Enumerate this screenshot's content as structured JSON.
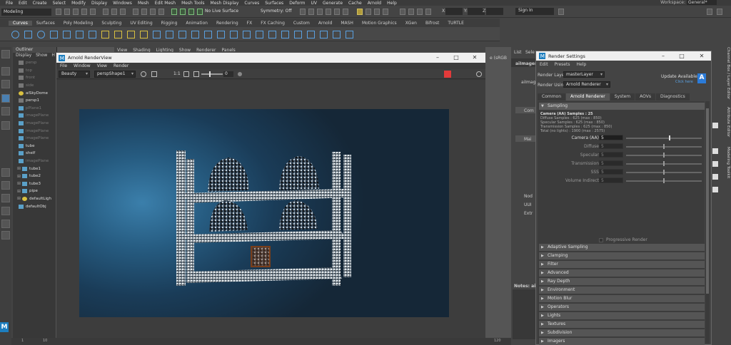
{
  "menubar": {
    "items": [
      "File",
      "Edit",
      "Create",
      "Select",
      "Modify",
      "Display",
      "Windows",
      "Mesh",
      "Edit Mesh",
      "Mesh Tools",
      "Mesh Display",
      "Curves",
      "Surfaces",
      "Deform",
      "UV",
      "Generate",
      "Cache",
      "Arnold",
      "Help"
    ],
    "workspace_label": "Workspace:",
    "workspace_value": "General*"
  },
  "status": {
    "mode": "Modeling",
    "live_surface": "No Live Surface",
    "symmetry": "Symmetry: Off",
    "x_label": "X:",
    "y_label": "Y:",
    "z_label": "Z:",
    "sign_in": "Sign In"
  },
  "shelf": {
    "tabs": [
      "Curves",
      "Surfaces",
      "Poly Modeling",
      "Sculpting",
      "UV Editing",
      "Rigging",
      "Animation",
      "Rendering",
      "FX",
      "FX Caching",
      "Custom",
      "Arnold",
      "MASH",
      "Motion Graphics",
      "XGen",
      "Bifrost",
      "TURTLE"
    ],
    "active_tab": 0
  },
  "outliner": {
    "title": "Outliner",
    "menu": [
      "Display",
      "Show",
      "H"
    ],
    "items": [
      {
        "label": "persp",
        "type": "cam",
        "dim": true,
        "expand": ""
      },
      {
        "label": "top",
        "type": "cam",
        "dim": true,
        "expand": ""
      },
      {
        "label": "front",
        "type": "cam",
        "dim": true,
        "expand": ""
      },
      {
        "label": "side",
        "type": "cam",
        "dim": true,
        "expand": ""
      },
      {
        "label": "aiSkyDome",
        "type": "light",
        "dim": false,
        "expand": ""
      },
      {
        "label": "persp1",
        "type": "cam",
        "dim": false,
        "expand": ""
      },
      {
        "label": "pPlane1",
        "type": "mesh",
        "dim": true,
        "expand": ""
      },
      {
        "label": "imagePlane",
        "type": "mesh",
        "dim": true,
        "expand": ""
      },
      {
        "label": "imagePlane",
        "type": "mesh",
        "dim": true,
        "expand": ""
      },
      {
        "label": "imagePlane",
        "type": "mesh",
        "dim": true,
        "expand": ""
      },
      {
        "label": "imagePlane",
        "type": "mesh",
        "dim": true,
        "expand": ""
      },
      {
        "label": "tube",
        "type": "mesh",
        "dim": false,
        "expand": ""
      },
      {
        "label": "shelf",
        "type": "mesh",
        "dim": false,
        "expand": ""
      },
      {
        "label": "imagePlane",
        "type": "mesh",
        "dim": true,
        "expand": ""
      },
      {
        "label": "tube1",
        "type": "mesh",
        "dim": false,
        "expand": "⊞"
      },
      {
        "label": "tube2",
        "type": "mesh",
        "dim": false,
        "expand": "⊞"
      },
      {
        "label": "tube3",
        "type": "mesh",
        "dim": false,
        "expand": "⊞"
      },
      {
        "label": "pipe",
        "type": "mesh",
        "dim": false,
        "expand": "⊞"
      },
      {
        "label": "defaultLigh",
        "type": "light",
        "dim": false,
        "expand": "⊞"
      },
      {
        "label": "defaultObj",
        "type": "mesh",
        "dim": false,
        "expand": ""
      }
    ]
  },
  "viewport": {
    "menu": [
      "View",
      "Shading",
      "Lighting",
      "Show",
      "Renderer",
      "Panels"
    ]
  },
  "render_view": {
    "title": "Arnold RenderView",
    "menu": [
      "File",
      "Window",
      "View",
      "Render"
    ],
    "aov": "Beauty",
    "camera": "perspShape1",
    "ratio": "1:1",
    "exposure": "0",
    "exposure_fraction": 0.35
  },
  "attr_editor": {
    "list": "List",
    "selected": "Sele",
    "node": "aiImagerC",
    "node2": "aiImag",
    "frag1": "Com",
    "frag2": "Mai",
    "frag3": "Nod",
    "frag4": "UUI",
    "frag5": "Extr",
    "notes": "Notes: ai",
    "colorspace": "e (sRGB"
  },
  "render_settings": {
    "title": "Render Settings",
    "menu": [
      "Edit",
      "Presets",
      "Help"
    ],
    "render_layer_label": "Render Layer",
    "render_layer": "masterLayer",
    "render_using_label": "Render Using",
    "render_using": "Arnold Renderer",
    "update_available": "Update Available",
    "click_here": "Click here",
    "tabs": [
      "Common",
      "Arnold Renderer",
      "System",
      "AOVs",
      "Diagnostics"
    ],
    "active_tab": 1,
    "sampling": {
      "title": "Sampling",
      "info": [
        "Camera (AA) Samples : 25",
        "Diffuse Samples : 625 (max : 850)",
        "Specular Samples : 625 (max : 850)",
        "Transmission Samples : 625 (max : 850)",
        "Total (no lights) : 1900 (max : 2575)"
      ],
      "rows": [
        {
          "label": "Camera (AA)",
          "value": "5",
          "on": true,
          "fraction": 0.58
        },
        {
          "label": "Diffuse",
          "value": "5",
          "on": false,
          "fraction": 0.5
        },
        {
          "label": "Specular",
          "value": "5",
          "on": false,
          "fraction": 0.5
        },
        {
          "label": "Transmission",
          "value": "5",
          "on": false,
          "fraction": 0.5
        },
        {
          "label": "SSS",
          "value": "5",
          "on": false,
          "fraction": 0.5
        },
        {
          "label": "Volume Indirect",
          "value": "5",
          "on": false,
          "fraction": 0.5
        }
      ],
      "progressive": "Progressive Render"
    },
    "sections": [
      "Adaptive Sampling",
      "Clamping",
      "Filter",
      "Advanced",
      "Ray Depth",
      "Environment",
      "Motion Blur",
      "Operators",
      "Lights",
      "Textures",
      "Subdivision",
      "Imagers"
    ]
  },
  "right_tabs": [
    "Channel Box / Layer Editor",
    "Attribute Editor",
    "Modeling Toolkit"
  ],
  "timeline": {
    "ticks": [
      "1",
      "10",
      "120",
      "120"
    ]
  },
  "maya_logo": "M",
  "arnold_logo": "A",
  "colors": {
    "accent": "#5aa0e0",
    "stop": "#e23a3a",
    "arnold": "#2b7bd8"
  }
}
